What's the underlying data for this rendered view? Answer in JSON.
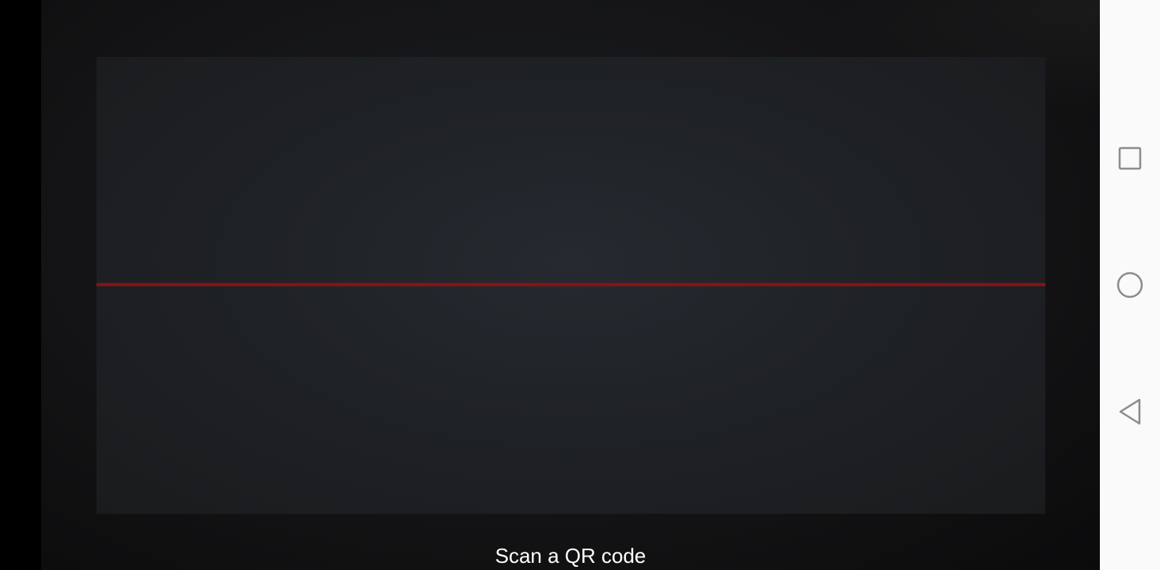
{
  "scanner": {
    "caption": "Scan a QR code",
    "laser_color": "#8a1414"
  },
  "nav_bar": {
    "recents_icon": "square-icon",
    "home_icon": "circle-icon",
    "back_icon": "triangle-back-icon"
  },
  "colors": {
    "nav_background": "#fafafa",
    "nav_icon": "#8c8c8c",
    "camera_background": "#141416"
  }
}
